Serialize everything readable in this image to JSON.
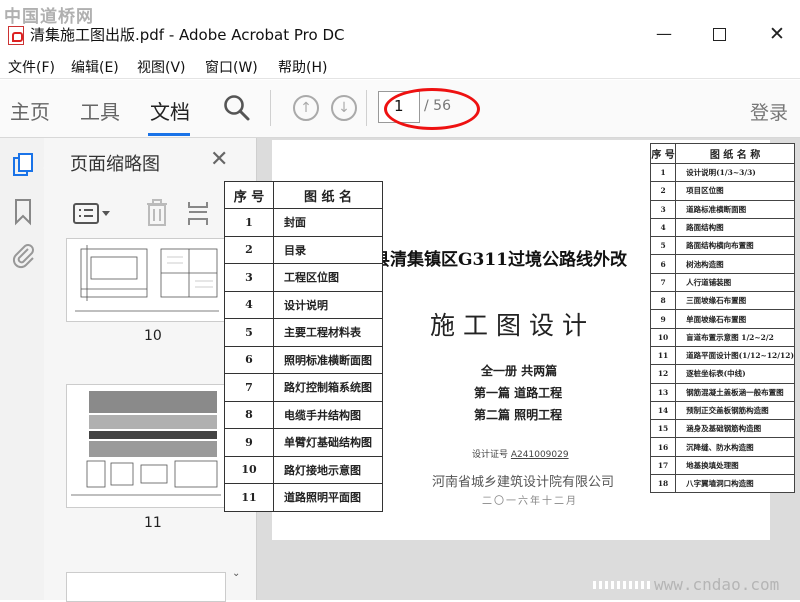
{
  "watermark": {
    "top": "中国道桥网",
    "bottom": "www.cndao.com"
  },
  "window": {
    "title": "清集施工图出版.pdf - Adobe Acrobat Pro DC"
  },
  "menu": [
    "文件(F)",
    "编辑(E)",
    "视图(V)",
    "窗口(W)",
    "帮助(H)"
  ],
  "toolbar": {
    "tabs": [
      "主页",
      "工具",
      "文档"
    ],
    "active_tab": "文档",
    "page_current": "1",
    "page_total": "/ 56",
    "login": "登录",
    "icons": [
      "search-icon",
      "prev-page-icon",
      "next-page-icon"
    ]
  },
  "colors": {
    "accent": "#1a73e8",
    "highlight": "#e11111"
  },
  "side_panel": {
    "title": "页面缩略图",
    "rail_icons": [
      "pages-icon",
      "bookmark-icon",
      "attachment-icon"
    ],
    "tool_icons": [
      "options-icon",
      "delete-icon",
      "insert-icon"
    ],
    "thumbnails": [
      {
        "label": "10"
      },
      {
        "label": "11"
      }
    ]
  },
  "document": {
    "cover": {
      "title": "县清集镇区G311过境公路线外改",
      "main": "施工图设计",
      "lines": [
        "全一册 共两篇",
        "第一篇 道路工程",
        "第二篇 照明工程"
      ],
      "cert_label": "设计证号",
      "cert_value": "A241009029",
      "company": "河南省城乡建筑设计院有限公司",
      "date": "二〇一六年十二月"
    },
    "left_table": {
      "header": [
        "序 号",
        "图 纸 名"
      ],
      "rows": [
        [
          "1",
          "封面"
        ],
        [
          "2",
          "目录"
        ],
        [
          "3",
          "工程区位图"
        ],
        [
          "4",
          "设计说明"
        ],
        [
          "5",
          "主要工程材料表"
        ],
        [
          "6",
          "照明标准横断面图"
        ],
        [
          "7",
          "路灯控制箱系统图"
        ],
        [
          "8",
          "电缆手井结构图"
        ],
        [
          "9",
          "单臂灯基础结构图"
        ],
        [
          "10",
          "路灯接地示意图"
        ],
        [
          "11",
          "道路照明平面图"
        ]
      ]
    },
    "right_table": {
      "header": [
        "序 号",
        "图 纸 名 称"
      ],
      "rows": [
        [
          "1",
          "设计说明(1/3~3/3)"
        ],
        [
          "2",
          "项目区位图"
        ],
        [
          "3",
          "道路标准横断面图"
        ],
        [
          "4",
          "路面结构图"
        ],
        [
          "5",
          "路面结构横向布置图"
        ],
        [
          "6",
          "树池构造图"
        ],
        [
          "7",
          "人行道铺装图"
        ],
        [
          "8",
          "三面坡缘石布置图"
        ],
        [
          "9",
          "单面坡缘石布置图"
        ],
        [
          "10",
          "盲道布置示意图 1/2~2/2"
        ],
        [
          "11",
          "道路平面设计图(1/12~12/12)"
        ],
        [
          "12",
          "逐桩坐标表(中线)"
        ],
        [
          "13",
          "钢筋混凝土盖板涵一般布置图"
        ],
        [
          "14",
          "预制正交盖板钢筋构造图"
        ],
        [
          "15",
          "涵身及基础钢筋构造图"
        ],
        [
          "16",
          "沉降缝、防水构造图"
        ],
        [
          "17",
          "地基换填处理图"
        ],
        [
          "18",
          "八字翼墙洞口构造图"
        ]
      ]
    }
  }
}
